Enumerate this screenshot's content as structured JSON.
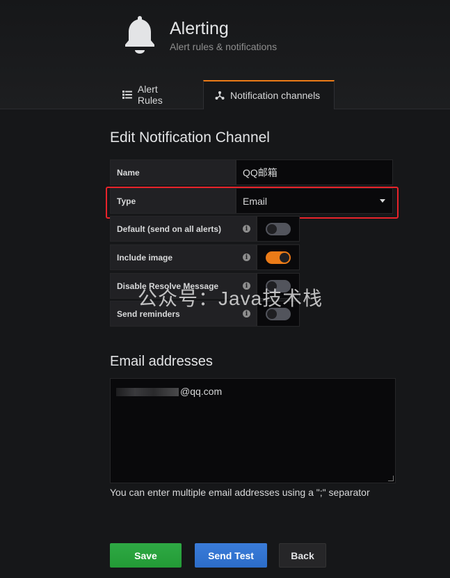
{
  "header": {
    "title": "Alerting",
    "subtitle": "Alert rules & notifications",
    "icon": "bell-icon"
  },
  "tabs": [
    {
      "label": "Alert Rules",
      "icon": "list-icon",
      "active": false
    },
    {
      "label": "Notification channels",
      "icon": "share-icon",
      "active": true
    }
  ],
  "form": {
    "title": "Edit Notification Channel",
    "name_label": "Name",
    "name_value": "QQ邮箱",
    "type_label": "Type",
    "type_value": "Email",
    "toggles": [
      {
        "label": "Default (send on all alerts)",
        "on": false
      },
      {
        "label": "Include image",
        "on": true
      },
      {
        "label": "Disable Resolve Message",
        "on": false
      },
      {
        "label": "Send reminders",
        "on": false
      }
    ]
  },
  "email": {
    "title": "Email addresses",
    "value_suffix": "@qq.com",
    "help": "You can enter multiple email addresses using a \";\" separator"
  },
  "watermark": "公众号：Java技术栈",
  "buttons": {
    "save": "Save",
    "send_test": "Send Test",
    "back": "Back"
  },
  "colors": {
    "accent": "#eb7b18",
    "save": "#2ea944",
    "send_test": "#3a7cd9",
    "highlight": "#e8232a"
  }
}
